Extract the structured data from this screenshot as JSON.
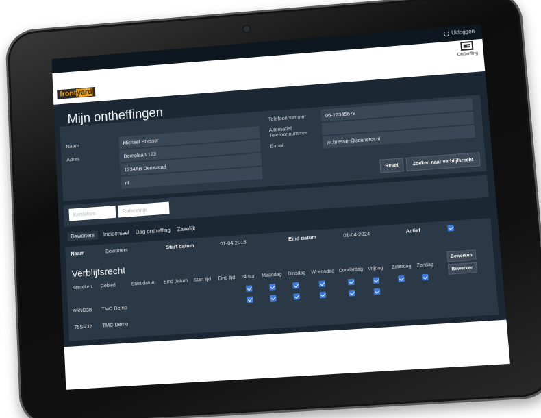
{
  "topbar": {
    "logout_label": "Uitloggen"
  },
  "brand": {
    "part1": "front",
    "part2": "yard"
  },
  "nav": {
    "ontheffing_label": "Ontheffing"
  },
  "page": {
    "title": "Mijn ontheffingen"
  },
  "person": {
    "naam_label": "Naam",
    "naam": "Michael Bresser",
    "adres_label": "Adres",
    "adres_line1": "Demolaan 123",
    "adres_line2": "1234AB Demostad",
    "adres_line3": "nl",
    "telefoon_label": "Telefoonnummer",
    "telefoon": "06-12345678",
    "alt_tel_label_1": "Alternatief",
    "alt_tel_label_2": "Telefoonnummer",
    "alt_tel": "",
    "email_label": "E-mail",
    "email": "m.bresser@scanetor.nl"
  },
  "actions": {
    "reset": "Reset",
    "search": "Zoeken naar verblijfsrecht"
  },
  "filters": {
    "kenteken_placeholder": "Kenteken",
    "referentie_placeholder": "Referentie"
  },
  "tabs": [
    {
      "label": "Bewoners"
    },
    {
      "label": "Incidenteel"
    },
    {
      "label": "Dag ontheffing"
    },
    {
      "label": "Zakelijk"
    }
  ],
  "bewoners_row": {
    "naam_header": "Naam",
    "naam_value": "Bewoners",
    "start_header": "Start datum",
    "start_value": "01-04-2015",
    "eind_header": "Eind datum",
    "eind_value": "01-04-2024",
    "actief_header": "Actief",
    "actief": true
  },
  "verblijfsrecht": {
    "title": "Verblijfsrecht",
    "columns": [
      "Kenteken",
      "Gebied",
      "Start datum",
      "Eind datum",
      "Start tijd",
      "Eind tijd",
      "24 uur",
      "Maandag",
      "Dinsdag",
      "Woensdag",
      "Donderdag",
      "Vrijdag",
      "Zaterdag",
      "Zondag"
    ],
    "rows": [
      {
        "kenteken": "65SG38",
        "gebied": "TMC Demo"
      },
      {
        "kenteken": "75SRJ2",
        "gebied": "TMC Demo"
      }
    ],
    "edit_label": "Bewerken"
  },
  "colors": {
    "accent": "#f0a21b",
    "checkbox": "#3f7bd6",
    "panel": "#2b3845",
    "bg": "#1b2733"
  }
}
